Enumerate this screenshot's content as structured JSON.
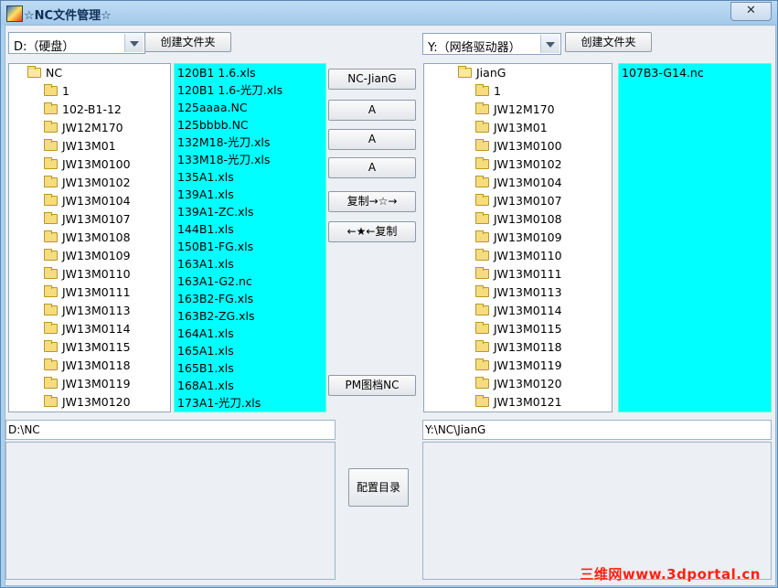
{
  "window": {
    "title": "☆NC文件管理☆",
    "close_label": "✕"
  },
  "left": {
    "drive": "D:（硬盘）",
    "create_folder_label": "创建文件夹",
    "tree": {
      "root": "NC",
      "folders": [
        "1",
        "102-B1-12",
        "JW12M170",
        "JW13M01",
        "JW13M0100",
        "JW13M0102",
        "JW13M0104",
        "JW13M0107",
        "JW13M0108",
        "JW13M0109",
        "JW13M0110",
        "JW13M0111",
        "JW13M0113",
        "JW13M0114",
        "JW13M0115",
        "JW13M0118",
        "JW13M0119",
        "JW13M0120"
      ]
    },
    "files": [
      "120B1 1.6.xls",
      "120B1 1.6-光刀.xls",
      "125aaaa.NC",
      "125bbbb.NC",
      "132M18-光刀.xls",
      "133M18-光刀.xls",
      "135A1.xls",
      "139A1.xls",
      "139A1-ZC.xls",
      "144B1.xls",
      "150B1-FG.xls",
      "163A1.xls",
      "163A1-G2.nc",
      "163B2-FG.xls",
      "163B2-ZG.xls",
      "164A1.xls",
      "165A1.xls",
      "165B1.xls",
      "168A1.xls",
      "173A1-光刀.xls"
    ],
    "path": "D:\\NC"
  },
  "middle": {
    "buttons": [
      "NC-JianG",
      "A",
      "A",
      "A",
      "复制→☆→",
      "←★←复制"
    ],
    "pm_button": "PM图档NC",
    "config_button": "配置目录"
  },
  "right": {
    "drive": "Y:（网络驱动器）",
    "create_folder_label": "创建文件夹",
    "tree": {
      "root": "JianG",
      "folders": [
        "1",
        "JW12M170",
        "JW13M01",
        "JW13M0100",
        "JW13M0102",
        "JW13M0104",
        "JW13M0107",
        "JW13M0108",
        "JW13M0109",
        "JW13M0110",
        "JW13M0111",
        "JW13M0113",
        "JW13M0114",
        "JW13M0115",
        "JW13M0118",
        "JW13M0119",
        "JW13M0120",
        "JW13M0121"
      ]
    },
    "files": [
      "107B3-G14.nc"
    ],
    "path": "Y:\\NC\\JianG"
  },
  "watermark": "三维网www.3dportal.cn",
  "colors": {
    "list_bg": "#00ffff",
    "window_frame": "#a9d1ef",
    "watermark": "#ff2211"
  }
}
